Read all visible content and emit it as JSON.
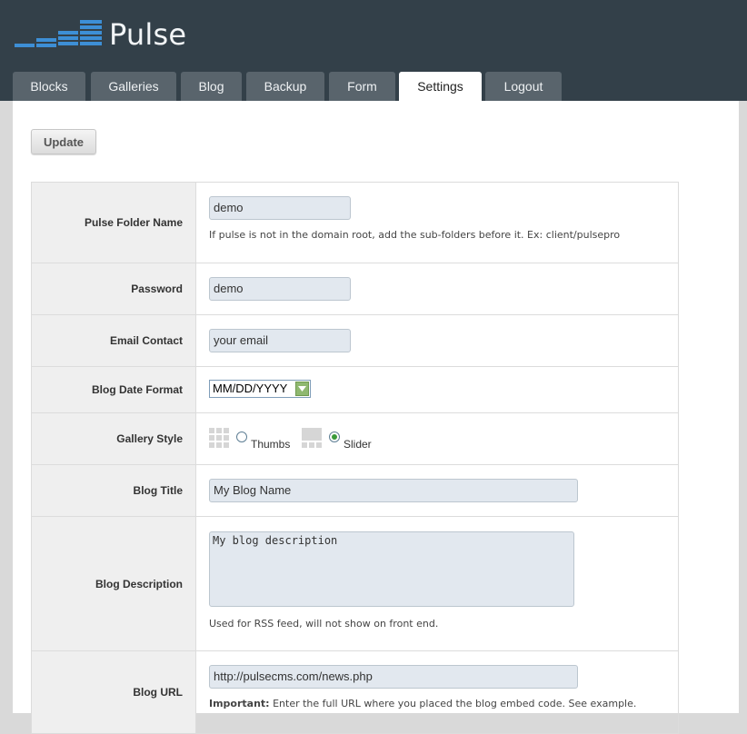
{
  "app": {
    "name": "Pulse"
  },
  "tabs": [
    {
      "label": "Blocks",
      "active": false
    },
    {
      "label": "Galleries",
      "active": false
    },
    {
      "label": "Blog",
      "active": false
    },
    {
      "label": "Backup",
      "active": false
    },
    {
      "label": "Form",
      "active": false
    },
    {
      "label": "Settings",
      "active": true
    },
    {
      "label": "Logout",
      "active": false
    }
  ],
  "toolbar": {
    "update_label": "Update"
  },
  "settings": {
    "folder": {
      "label": "Pulse Folder Name",
      "value": "demo",
      "hint": "If pulse is not in the domain root, add the sub-folders before it. Ex: client/pulsepro"
    },
    "password": {
      "label": "Password",
      "value": "demo"
    },
    "email": {
      "label": "Email Contact",
      "value": "your email"
    },
    "date_format": {
      "label": "Blog Date Format",
      "selected": "MM/DD/YYYY"
    },
    "gallery_style": {
      "label": "Gallery Style",
      "options": [
        {
          "label": "Thumbs",
          "checked": false
        },
        {
          "label": "Slider",
          "checked": true
        }
      ]
    },
    "blog_title": {
      "label": "Blog Title",
      "value": "My Blog Name"
    },
    "blog_description": {
      "label": "Blog Description",
      "value": "My blog description",
      "hint": "Used for RSS feed, will not show on front end."
    },
    "blog_url": {
      "label": "Blog URL",
      "value": "http://pulsecms.com/news.php",
      "hint_bold": "Important:",
      "hint": " Enter the full URL where you placed the blog embed code. See example."
    }
  },
  "colors": {
    "header_bg": "#334049",
    "tab_bg": "#59646c",
    "logo_accent": "#3d8fd6",
    "input_bg": "#e2e8ef"
  }
}
